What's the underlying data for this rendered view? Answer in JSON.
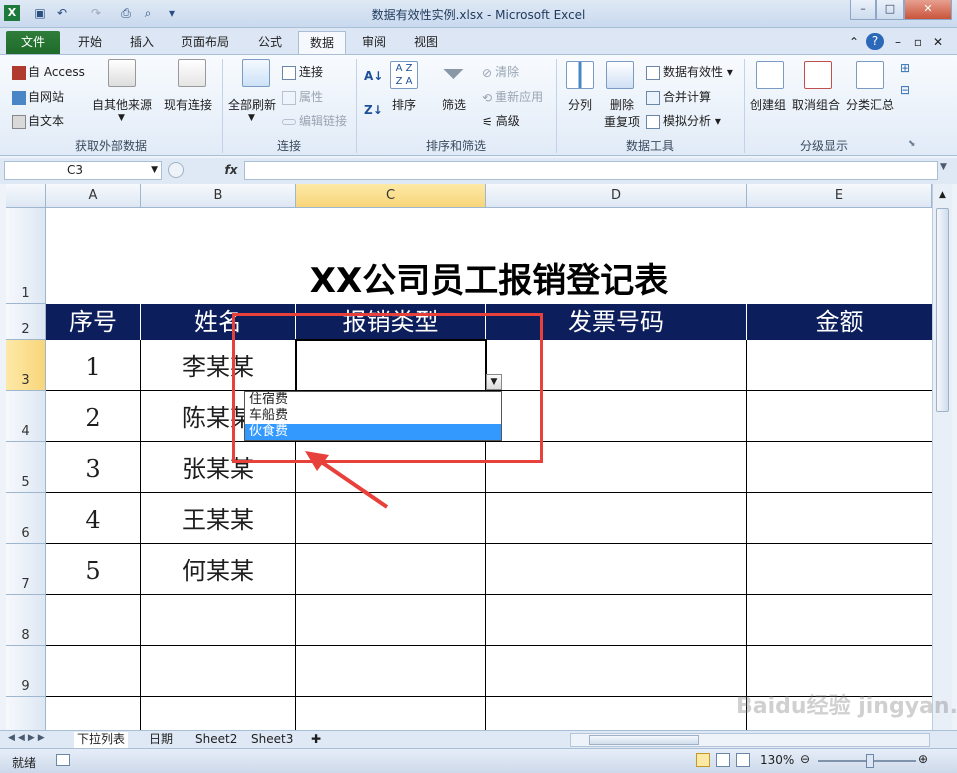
{
  "window": {
    "title": "数据有效性实例.xlsx - Microsoft Excel"
  },
  "tabs": [
    "文件",
    "开始",
    "插入",
    "页面布局",
    "公式",
    "数据",
    "审阅",
    "视图"
  ],
  "active_tab": "数据",
  "ribbon": {
    "ext": {
      "access": "自 Access",
      "web": "自网站",
      "text": "自文本",
      "other": "自其他来源",
      "existing": "现有连接",
      "group": "获取外部数据"
    },
    "conn": {
      "refresh": "全部刷新",
      "connections": "连接",
      "properties": "属性",
      "edit_links": "编辑链接",
      "group": "连接"
    },
    "sort": {
      "sort": "排序",
      "filter": "筛选",
      "clear": "清除",
      "reapply": "重新应用",
      "advanced": "高级",
      "group": "排序和筛选"
    },
    "tools": {
      "split": "分列",
      "remove_dup_1": "删除",
      "remove_dup_2": "重复项",
      "validation": "数据有效性",
      "consolidate": "合并计算",
      "whatif": "模拟分析",
      "group": "数据工具"
    },
    "outline": {
      "group_btn": "创建组",
      "ungroup": "取消组合",
      "subtotal": "分类汇总",
      "group": "分级显示"
    }
  },
  "formula_bar": {
    "name_box": "C3",
    "fx": "fx",
    "value": ""
  },
  "columns": [
    "A",
    "B",
    "C",
    "D",
    "E"
  ],
  "rows": [
    "1",
    "2",
    "3",
    "4",
    "5",
    "6",
    "7",
    "8",
    "9"
  ],
  "sheet": {
    "title": "XX公司员工报销登记表",
    "headers": [
      "序号",
      "姓名",
      "报销类型",
      "发票号码",
      "金额"
    ],
    "data": [
      [
        "1",
        "李某某",
        "",
        "",
        ""
      ],
      [
        "2",
        "陈某某",
        "",
        "",
        ""
      ],
      [
        "3",
        "张某某",
        "",
        "",
        ""
      ],
      [
        "4",
        "王某某",
        "",
        "",
        ""
      ],
      [
        "5",
        "何某某",
        "",
        "",
        ""
      ]
    ]
  },
  "dropdown": {
    "options": [
      "住宿费",
      "车船费",
      "伙食费"
    ],
    "highlighted": "伙食费"
  },
  "sheet_tabs": [
    "下拉列表",
    "日期",
    "Sheet2",
    "Sheet3"
  ],
  "active_sheet": "下拉列表",
  "status": {
    "ready": "就绪",
    "zoom": "130%"
  },
  "watermark": "Baidu经验 jingyan.baidu.com",
  "colors": {
    "header_fill": "#0c1f5c",
    "annotation": "#e8403a",
    "selection": "#3399ff",
    "file_tab": "#2a7a36"
  }
}
